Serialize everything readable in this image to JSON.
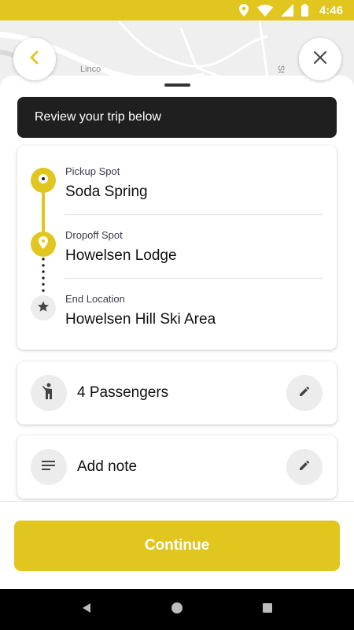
{
  "status_bar": {
    "time": "4:46",
    "icons": [
      "location-icon",
      "wifi-icon",
      "signal-icon",
      "battery-icon"
    ],
    "background": "#e0c61f"
  },
  "map": {
    "labels": [
      "Linco",
      "St"
    ]
  },
  "header": {
    "back_icon": "chevron-left-icon",
    "close_icon": "close-icon"
  },
  "banner": {
    "text": "Review your trip below"
  },
  "trip": {
    "stops": [
      {
        "label": "Pickup Spot",
        "value": "Soda Spring",
        "icon": "pickup-marker-icon"
      },
      {
        "label": "Dropoff Spot",
        "value": "Howelsen Lodge",
        "icon": "dropoff-pin-icon"
      },
      {
        "label": "End Location",
        "value": "Howelsen Hill Ski Area",
        "icon": "star-icon"
      }
    ]
  },
  "passengers": {
    "text": "4 Passengers",
    "icon": "person-icon",
    "edit_icon": "pencil-icon"
  },
  "note": {
    "text": "Add note",
    "icon": "notes-icon",
    "edit_icon": "pencil-icon"
  },
  "footer": {
    "continue_label": "Continue"
  },
  "colors": {
    "accent": "#e0c61f",
    "banner": "#1f1f1f",
    "icon_circle": "#ececec"
  }
}
